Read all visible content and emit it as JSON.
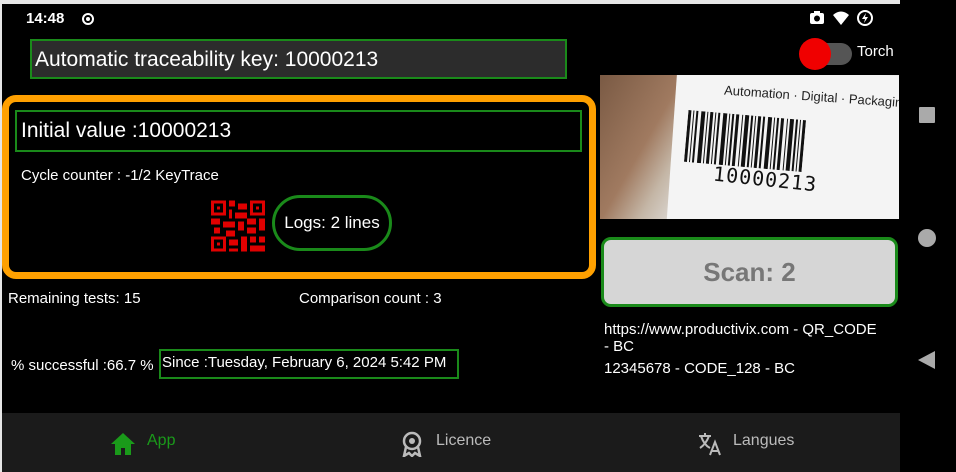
{
  "status_bar": {
    "time": "14:48",
    "icons": [
      "record-icon",
      "screenshot-icon",
      "wifi-icon",
      "battery-saver-icon"
    ]
  },
  "header": {
    "key_label": "Automatic traceability key: 10000213",
    "torch_label": "Torch",
    "torch_color": "#f00000"
  },
  "card": {
    "initial_value": "Initial value :10000213",
    "cycle_counter": "Cycle counter : -1/2 KeyTrace",
    "logs_label": "Logs: 2 lines",
    "accent_color": "#ffa000",
    "qr_color": "#e00000"
  },
  "stats": {
    "remaining": "Remaining tests: 15",
    "comparison": "Comparison count : 3",
    "success": "% successful :66.7 %",
    "since": "Since :Tuesday, February 6, 2024 5:42 PM"
  },
  "camera": {
    "label_text": "Automation · Digital · Packaging",
    "barcode_number": "10000213"
  },
  "scan": {
    "button_label": "Scan: 2",
    "result_line1": "https://www.productivix.com - QR_CODE",
    "result_line1b": "- BC",
    "result_line2": "12345678 - CODE_128 - BC"
  },
  "bottom_nav": {
    "app": "App",
    "licence": "Licence",
    "langues": "Langues",
    "active_color": "#1a9a1a",
    "inactive_color": "#bbbbbb"
  },
  "colors": {
    "green_border": "#1a8a1a",
    "background": "#000000"
  }
}
